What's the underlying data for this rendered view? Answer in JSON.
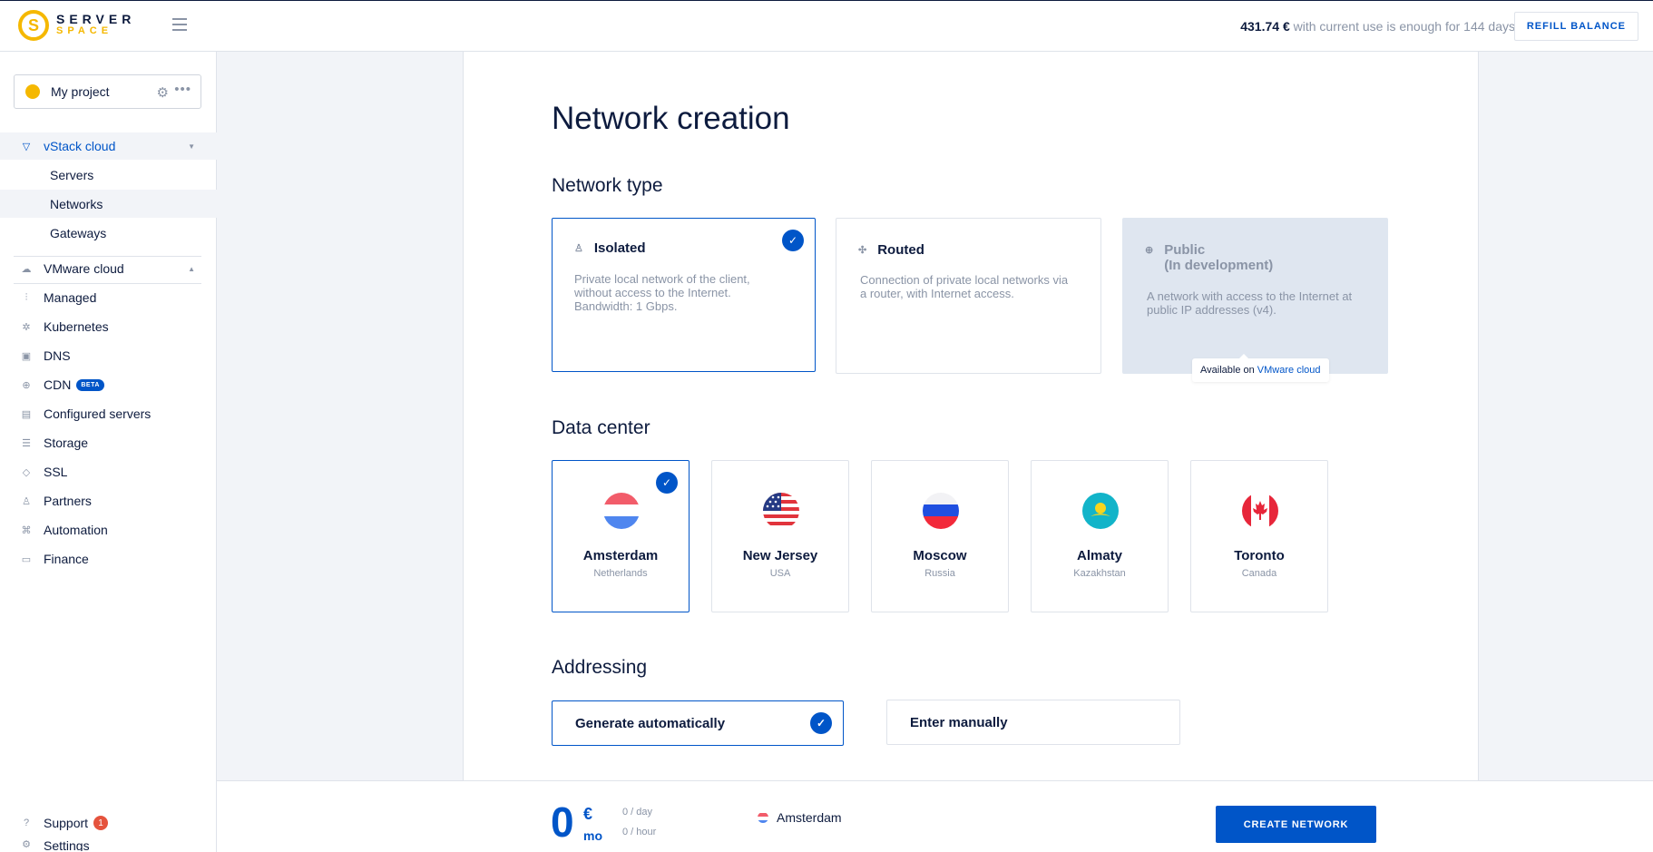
{
  "header": {
    "logo_line1": "SERVER",
    "logo_line2": "SPACE",
    "logo_mark": "S",
    "balance_amount": "431.74 €",
    "balance_text": " with current use is enough for 144 days",
    "refill_label": "REFILL BALANCE"
  },
  "project": {
    "name": "My project",
    "gear_icon": "gear-icon",
    "more_icon": "more-icon"
  },
  "sidebar": {
    "vstack": {
      "label": "vStack cloud",
      "icon": "vstack-icon"
    },
    "vstack_items": [
      {
        "label": "Servers"
      },
      {
        "label": "Networks"
      },
      {
        "label": "Gateways"
      }
    ],
    "items": [
      {
        "label": "VMware cloud",
        "icon": "cloud-icon"
      },
      {
        "label": "Managed",
        "icon": "managed-icon"
      },
      {
        "label": "Kubernetes",
        "icon": "kubernetes-icon"
      },
      {
        "label": "DNS",
        "icon": "dns-icon"
      },
      {
        "label": "CDN",
        "icon": "globe-icon",
        "badge": "BETA"
      },
      {
        "label": "Configured servers",
        "icon": "configured-servers-icon"
      },
      {
        "label": "Storage",
        "icon": "storage-icon"
      },
      {
        "label": "SSL",
        "icon": "shield-icon"
      },
      {
        "label": "Partners",
        "icon": "partners-icon"
      },
      {
        "label": "Automation",
        "icon": "command-icon"
      },
      {
        "label": "Finance",
        "icon": "card-icon"
      }
    ],
    "support": {
      "label": "Support",
      "count": "1",
      "icon": "question-icon"
    },
    "settings": {
      "label": "Settings"
    }
  },
  "main": {
    "title": "Network creation",
    "network_type": {
      "heading": "Network type",
      "options": [
        {
          "title": "Isolated",
          "desc_lines": [
            "Private local network of the client,",
            "without access to the Internet.",
            "Bandwidth: 1 Gbps."
          ],
          "selected": true,
          "icon": "isolated-icon"
        },
        {
          "title": "Routed",
          "desc_lines": [
            "Connection of private local networks via",
            "a router, with Internet access."
          ],
          "selected": false,
          "icon": "routed-icon"
        },
        {
          "title_lines": [
            "Public",
            "(In development)"
          ],
          "desc_lines": [
            "A network with access to the Internet at",
            "public IP addresses (v4)."
          ],
          "disabled": true,
          "icon": "globe-icon",
          "tooltip_text": "Available on ",
          "tooltip_link": "VMware cloud"
        }
      ]
    },
    "data_center": {
      "heading": "Data center",
      "options": [
        {
          "city": "Amsterdam",
          "country": "Netherlands",
          "selected": true
        },
        {
          "city": "New Jersey",
          "country": "USA"
        },
        {
          "city": "Moscow",
          "country": "Russia"
        },
        {
          "city": "Almaty",
          "country": "Kazakhstan"
        },
        {
          "city": "Toronto",
          "country": "Canada"
        }
      ]
    },
    "addressing": {
      "heading": "Addressing",
      "options": [
        {
          "label": "Generate automatically",
          "selected": true
        },
        {
          "label": "Enter manually"
        }
      ]
    }
  },
  "footer": {
    "price": "0",
    "currency": "€",
    "period": "mo",
    "per_day": "0 / day",
    "per_hour": "0 / hour",
    "location": "Amsterdam",
    "create_label": "CREATE NETWORK"
  },
  "colors": {
    "accent": "#0055c8",
    "brand": "#f5b800",
    "muted": "#8a94a6",
    "text": "#0d1b3e"
  }
}
